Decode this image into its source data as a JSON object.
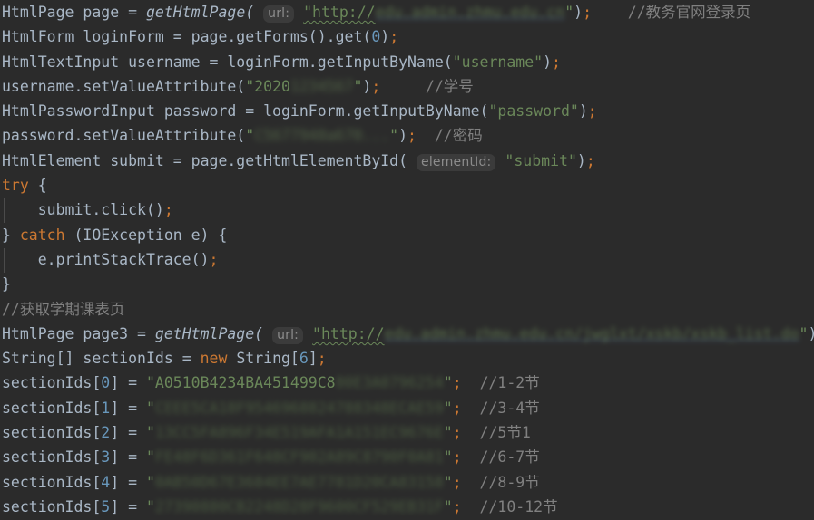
{
  "editor": {
    "theme": "darcula",
    "background_color": "#2b2b2b",
    "foreground_color": "#a9b7c6",
    "keyword_color": "#cc7832",
    "string_color": "#6a8759",
    "number_color": "#6897bb",
    "comment_color": "#808080",
    "hint_background_color": "#3b3b3b",
    "hint_text_color": "#8c8c8c",
    "language": "Java",
    "line_count": 21
  },
  "hints": {
    "url": "url:",
    "element_id": "elementId:"
  },
  "lines": [
    {
      "n": 1,
      "type_1": "HtmlPage",
      "var_1": "page",
      "eq": "=",
      "call": "getHtmlPage(",
      "hint": "url:",
      "string_visible": "\"http://",
      "string_redacted": "edu.admin.zhmu.edu.cn",
      "tail": "\");",
      "comment": "//教务官网登录页"
    },
    {
      "n": 2,
      "text": "HtmlForm loginForm = page.getForms().get(0);",
      "type_1": "HtmlForm",
      "var_1": "loginForm",
      "call": "page.getForms().get(",
      "num": "0",
      "tail": ");"
    },
    {
      "n": 3,
      "type_1": "HtmlTextInput",
      "var_1": "username",
      "call": "loginForm.getInputByName(",
      "string": "\"username\"",
      "tail": ");"
    },
    {
      "n": 4,
      "call": "username.setValueAttribute(",
      "string_visible": "\"2020",
      "string_redacted": "1234567",
      "tail": "\");",
      "comment": "//学号"
    },
    {
      "n": 5,
      "type_1": "HtmlPasswordInput",
      "var_1": "password",
      "call": "loginForm.getInputByName(",
      "string": "\"password\"",
      "tail": ");"
    },
    {
      "n": 6,
      "call": "password.setValueAttribute(",
      "string_redacted": "C5677948a670...",
      "tail": "\");",
      "comment": "//密码"
    },
    {
      "n": 7,
      "type_1": "HtmlElement",
      "var_1": "submit",
      "call": "page.getHtmlElementById(",
      "hint": "elementId:",
      "string": "\"submit\"",
      "tail": ");"
    },
    {
      "n": 8,
      "keyword": "try",
      "text": "try {"
    },
    {
      "n": 9,
      "text": "submit.click();"
    },
    {
      "n": 10,
      "keyword": "catch",
      "text": "} catch (IOException e) {"
    },
    {
      "n": 11,
      "text": "e.printStackTrace();"
    },
    {
      "n": 12,
      "text": "}"
    },
    {
      "n": 13,
      "comment": "//获取学期课表页"
    },
    {
      "n": 14,
      "type_1": "HtmlPage",
      "var_1": "page3",
      "call": "getHtmlPage(",
      "hint": "url:",
      "string_visible": "\"http://",
      "string_redacted": "edu.admin.zhmu.edu.cn/jwglxt/xskb/xskb_list.do",
      "tail": "\");"
    },
    {
      "n": 15,
      "type_1": "String[]",
      "var_1": "sectionIds",
      "keyword": "new",
      "type_2": "String[",
      "num": "6",
      "tail": "];"
    },
    {
      "n": 16,
      "array": "sectionIds[",
      "index": "0",
      "string_visible": "\"A0510B4234BA451499C8",
      "string_redacted": "80E3A0796254",
      "tail": "\";",
      "comment": "//1-2节"
    },
    {
      "n": 17,
      "array": "sectionIds[",
      "index": "1",
      "string_visible": "\"",
      "string_redacted": "CEEE5CA18F9546968824788348ECAE59",
      "tail": "\";",
      "comment": "//3-4节"
    },
    {
      "n": 18,
      "array": "sectionIds[",
      "index": "2",
      "string_visible": "\"",
      "string_redacted": "13CC5FA896F34E519AFA1A151EC9676E",
      "tail": "\";",
      "comment": "//5节1"
    },
    {
      "n": 19,
      "array": "sectionIds[",
      "index": "3",
      "string_visible": "\"",
      "string_redacted": "FE48F6D361F648CF902A89C8790F0A81",
      "tail": "\";",
      "comment": "//6-7节"
    },
    {
      "n": 20,
      "array": "sectionIds[",
      "index": "4",
      "string_visible": "\"",
      "string_redacted": "0AB50D67E3684EE7AE7781D20CA83158",
      "tail": "\";",
      "comment": "//8-9节"
    },
    {
      "n": 21,
      "array": "sectionIds[",
      "index": "5",
      "string_visible": "\"",
      "string_redacted": "27390880CB2248D28F9600CF529EB31F",
      "tail": "\";",
      "comment": "//10-12节"
    }
  ]
}
